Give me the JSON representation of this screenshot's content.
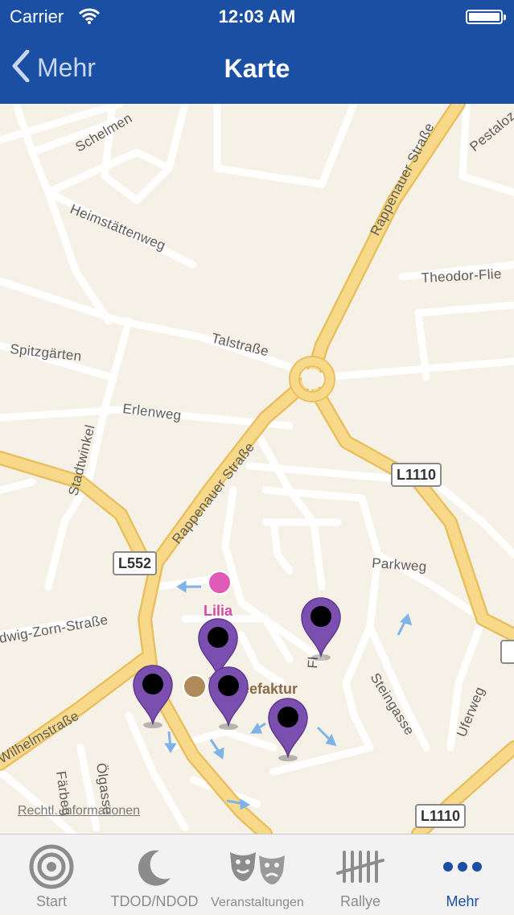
{
  "status_bar": {
    "carrier": "Carrier",
    "time": "12:03 AM"
  },
  "nav": {
    "back_label": "Mehr",
    "title": "Karte"
  },
  "map": {
    "streets": {
      "rappenauer_1": "Rappenauer Straße",
      "rappenauer_2": "Rappenauer Straße",
      "heimstaettenweg": "Heimstättenweg",
      "schelmen": "Schelmen",
      "talstrasse": "Talstraße",
      "spitzgaerten": "Spitzgärten",
      "erlenweg": "Erlenweg",
      "stadtwinkel": "Stadtwinkel",
      "theodor": "Theodor-Flie",
      "pestaloz": "Pestaloz",
      "parkweg": "Parkweg",
      "zorn": "dwig-Zorn-Straße",
      "wilhelm": "Wilhelmstraße",
      "steingasse": "Steingasse",
      "uferweg": "Uferweg",
      "olgasse": "Ölgasse",
      "farbe": "Färbeg",
      "fl": "Fl"
    },
    "road_shields": [
      "L1110",
      "L552",
      "L1110"
    ],
    "pois": {
      "lilia": "Lilia",
      "cafe": "eefaktur"
    },
    "legal_link": "Rechtl. Informationen"
  },
  "tabs": [
    {
      "label": "Start",
      "icon": "target-icon",
      "active": false
    },
    {
      "label": "TDOD/NDOD",
      "icon": "moon-icon",
      "active": false
    },
    {
      "label": "Veranstaltungen",
      "icon": "theater-masks-icon",
      "active": false
    },
    {
      "label": "Rallye",
      "icon": "tally-marks-icon",
      "active": false
    },
    {
      "label": "Mehr",
      "icon": "more-dots-icon",
      "active": true
    }
  ],
  "colors": {
    "nav_blue": "#1a4fa3",
    "pin_purple": "#7b4fb0",
    "road_yellow": "#f5cf6a"
  }
}
